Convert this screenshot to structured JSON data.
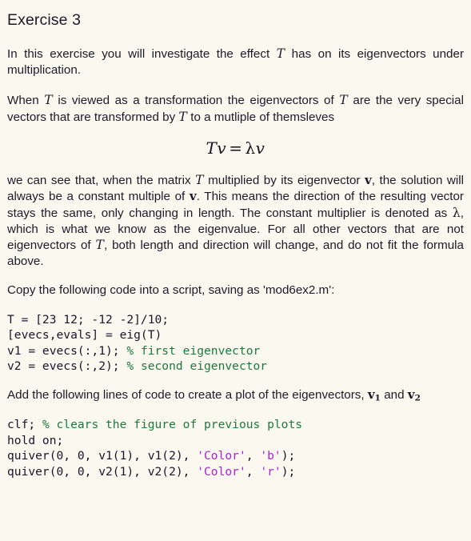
{
  "document": {
    "title": "Exercise 3",
    "background_color": "#fbf8f0",
    "text_color": "#1b1b29",
    "comment_color": "#1d7a3c",
    "string_color": "#ac22d6",
    "paragraph_1": {
      "part_1": "In this exercise you will investigate the effect ",
      "math_T": "T",
      "part_2": " has on its eigenvectors under multiplication."
    },
    "paragraph_2": {
      "part_1": "When ",
      "math_T1": "T",
      "part_2": " is viewed as a transformation the eigenvectors of ",
      "math_T2": "T",
      "part_3": " are the very special vectors that are transformed by ",
      "math_T3": "T",
      "part_4": " to a mutliple of themsleves"
    },
    "equation": {
      "lhs_T": "T",
      "lhs_v": "v",
      "operator": "=",
      "rhs_lambda": "λ",
      "rhs_v": "v"
    },
    "paragraph_3": {
      "part_1": "we can see that, when the matrix ",
      "math_T1": "T",
      "part_2": " multiplied by its eigenvector ",
      "vec_v1": "v",
      "part_3": ", the solution will always be a constant multiple of ",
      "vec_v2": "v",
      "part_4": ". This means the direction of the resulting vector stays the same, only changing in length. The constant multiplier is denoted as ",
      "math_lambda": "λ",
      "part_5": ", which is what we know as the eigenvalue. For all other vectors that are not eigenvectors of ",
      "math_T2": "T",
      "part_6": ", both length and direction will change, and do not fit the formula above."
    },
    "paragraph_4": {
      "text": "Copy the following code into a script, saving as 'mod6ex2.m':"
    },
    "code_block_1": {
      "line_1": "T = [23 12; -12 -2]/10;",
      "line_2": "[evecs,evals] = eig(T)",
      "line_3_code": "v1 = evecs(:,1); ",
      "line_3_comment": "% first eigenvector",
      "line_4_code": "v2 = evecs(:,2); ",
      "line_4_comment": "% second eigenvector"
    },
    "paragraph_5": {
      "part_1": "Add the following lines of code to create a plot of the eigenvectors, ",
      "vec_v1": "v",
      "vec_v1_sub": "1",
      "part_2": " and ",
      "vec_v2": "v",
      "vec_v2_sub": "2"
    },
    "code_block_2": {
      "line_1_code": "clf; ",
      "line_1_comment": "% clears the figure of previous plots",
      "line_2": "hold on;",
      "line_3_a": "quiver(0, 0, v1(1), v1(2), ",
      "line_3_str1": "'Color'",
      "line_3_b": ", ",
      "line_3_str2": "'b'",
      "line_3_c": ");",
      "line_4_a": "quiver(0, 0, v2(1), v2(2), ",
      "line_4_str1": "'Color'",
      "line_4_b": ", ",
      "line_4_str2": "'r'",
      "line_4_c": ");"
    }
  }
}
